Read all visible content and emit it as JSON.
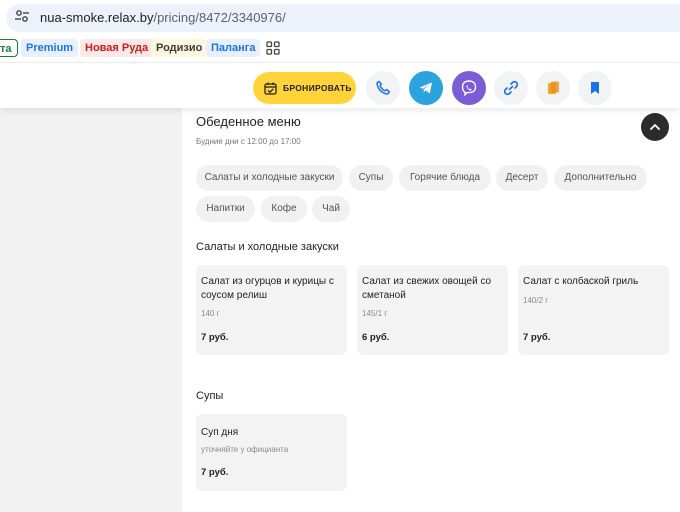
{
  "browser": {
    "url_host": "nua-smoke.relax.by",
    "url_path": "/pricing/8472/3340976/"
  },
  "bookmarks": [
    {
      "label": "та",
      "color": "#188038",
      "bg": "#ffffff",
      "border": "#188038"
    },
    {
      "label": "Premium",
      "color": "#1a73e8",
      "bg": "#e8f0fe",
      "border": "none"
    },
    {
      "label": "Новая Руда",
      "color": "#c5221f",
      "bg": "#fce8e6",
      "border": "none"
    },
    {
      "label": "Родизио",
      "color": "#3c3c3c",
      "bg": "#fef7e0",
      "border": "none"
    },
    {
      "label": "Паланга",
      "color": "#1a73e8",
      "bg": "#e8f0fe",
      "border": "none"
    }
  ],
  "actions": {
    "book_label": "БРОНИРОВАТЬ",
    "buttons": [
      {
        "name": "phone-icon",
        "bg": "#f1f3f4"
      },
      {
        "name": "telegram-icon",
        "bg": "#2aa3df"
      },
      {
        "name": "viber-icon",
        "bg": "#7b5cd6"
      },
      {
        "name": "link-icon",
        "bg": "#f1f3f4"
      },
      {
        "name": "copy-icon",
        "bg": "#f1f3f4"
      },
      {
        "name": "bookmark-icon",
        "bg": "#f1f3f4"
      }
    ]
  },
  "menu": {
    "title": "Обеденное меню",
    "hours": "Будние дни с 12:00 до 17:00",
    "categories": [
      "Салаты и холодные закуски",
      "Супы",
      "Горячие блюда",
      "Десерт",
      "Дополнительно",
      "Напитки",
      "Кофе",
      "Чай"
    ],
    "sections": [
      {
        "title": "Салаты и холодные закуски",
        "items": [
          {
            "name": "Салат из огурцов и курицы с соусом релиш",
            "weight": "140 г",
            "price": "7 руб."
          },
          {
            "name": "Салат из свежих овощей со сметаной",
            "weight": "145/1 г",
            "price": "6 руб."
          },
          {
            "name": "Салат с колбаской гриль",
            "weight": "140/2 г",
            "price": "7 руб."
          }
        ]
      },
      {
        "title": "Супы",
        "items": [
          {
            "name": "Суп дня",
            "weight": "уточняйте у официанта",
            "price": "7 руб."
          }
        ]
      }
    ]
  }
}
